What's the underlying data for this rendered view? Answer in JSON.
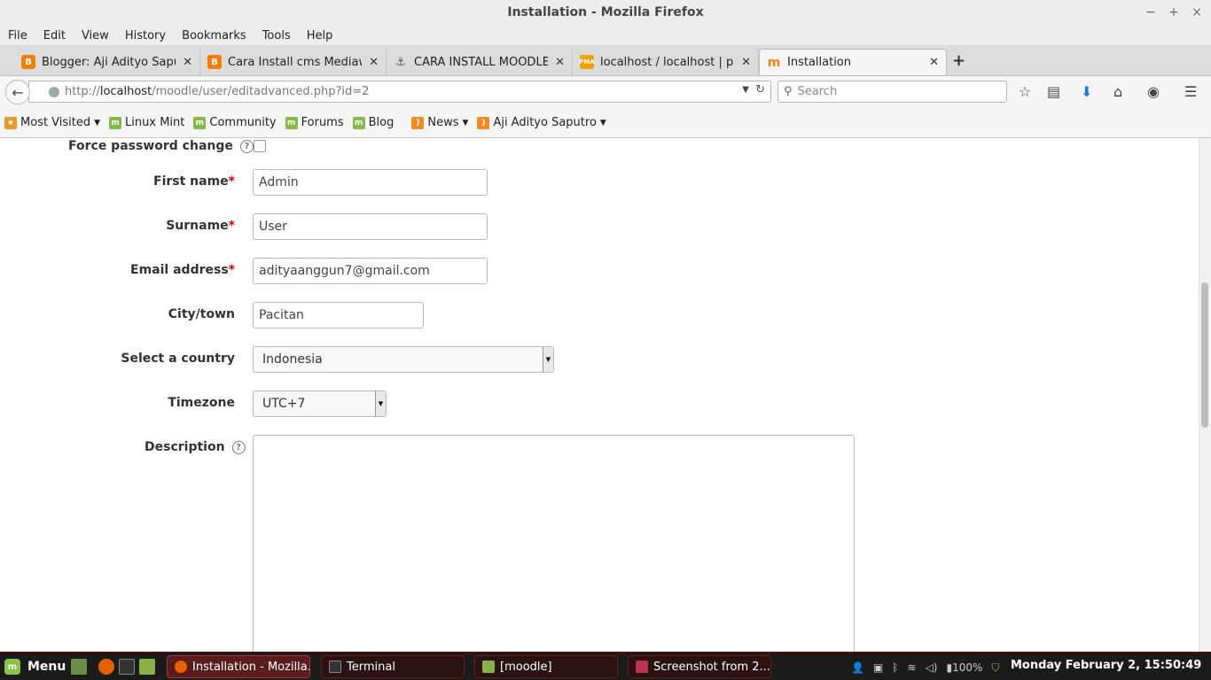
{
  "window": {
    "title": "Installation - Mozilla Firefox",
    "min_glyph": "−",
    "max_glyph": "+",
    "close_glyph": "×"
  },
  "menubar": [
    "File",
    "Edit",
    "View",
    "History",
    "Bookmarks",
    "Tools",
    "Help"
  ],
  "tabs": [
    {
      "label": "Blogger: Aji Adityo Saputr...",
      "icon": "blogger-icon",
      "color": "#f57d00"
    },
    {
      "label": "Cara Install cms Mediawi...",
      "icon": "blogger-icon",
      "color": "#f57d00"
    },
    {
      "label": "CARA INSTALL MOODLE ...",
      "icon": "anchor-icon",
      "color": "#555555"
    },
    {
      "label": "localhost / localhost | ph...",
      "icon": "phpmyadmin-icon",
      "color": "#f0a000"
    },
    {
      "label": "Installation",
      "icon": "moodle-icon",
      "color": "#f98012"
    }
  ],
  "url": {
    "prefix": "http://",
    "host": "localhost",
    "path": "/moodle/user/editadvanced.php?id=2"
  },
  "search": {
    "placeholder": "Search"
  },
  "bookmarks": [
    {
      "label": "Most Visited",
      "icon": "most-visited-icon",
      "dropdown": true
    },
    {
      "label": "Linux Mint",
      "icon": "mint-icon",
      "dropdown": false
    },
    {
      "label": "Community",
      "icon": "mint-icon",
      "dropdown": false
    },
    {
      "label": "Forums",
      "icon": "mint-icon",
      "dropdown": false
    },
    {
      "label": "Blog",
      "icon": "mint-icon",
      "dropdown": false
    },
    {
      "label": "News",
      "icon": "rss-icon",
      "dropdown": true
    },
    {
      "label": "Aji Adityo Saputro",
      "icon": "rss-icon",
      "dropdown": true
    }
  ],
  "form": {
    "force_password_label": "Force password change",
    "first_name_label": "First name",
    "first_name_value": "Admin",
    "surname_label": "Surname",
    "surname_value": "User",
    "email_label": "Email address",
    "email_value": "adityaanggun7@gmail.com",
    "city_label": "City/town",
    "city_value": "Pacitan",
    "country_label": "Select a country",
    "country_value": "Indonesia",
    "timezone_label": "Timezone",
    "timezone_value": "UTC+7",
    "description_label": "Description",
    "required_mark": "*",
    "help_glyph": "?"
  },
  "taskbar": {
    "menu_label": "Menu",
    "tasks": [
      {
        "label": "Installation - Mozilla...",
        "active": true
      },
      {
        "label": "Terminal",
        "active": false
      },
      {
        "label": "[moodle]",
        "active": false
      },
      {
        "label": "Screenshot from 2...",
        "active": false
      }
    ],
    "battery": "100%",
    "clock": "Monday February  2, 15:50:49"
  },
  "colors": {
    "required": "#cc0000",
    "taskbar_bg": "#1b1b1b",
    "taskbar_accent": "#a33333"
  }
}
